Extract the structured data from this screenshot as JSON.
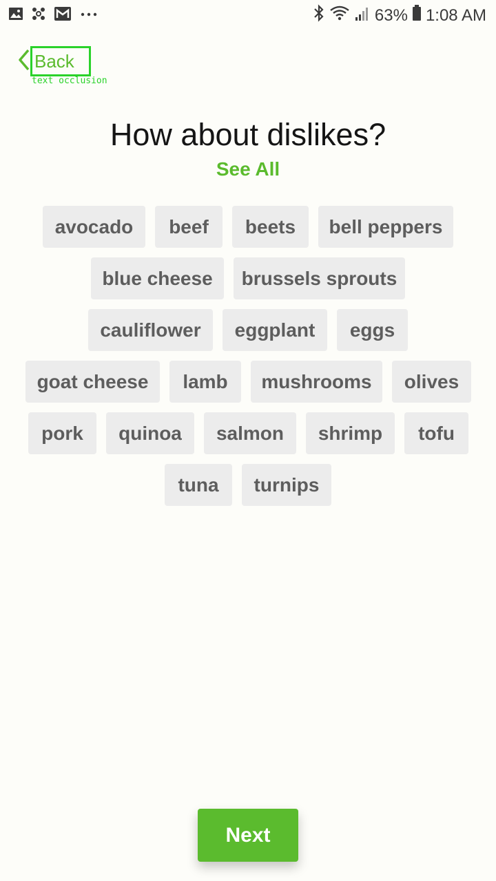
{
  "status_bar": {
    "battery": "63%",
    "time": "1:08 AM",
    "left_icons": [
      "image-icon",
      "pinwheel-icon",
      "gmail-icon",
      "more-dots-icon"
    ],
    "right_icons": [
      "bluetooth-icon",
      "wifi-icon",
      "signal-icon",
      "battery-icon"
    ]
  },
  "nav": {
    "back_label": "Back",
    "occlusion_label": "text occlusion"
  },
  "heading": {
    "title": "How about dislikes?",
    "see_all": "See All"
  },
  "chips": [
    "avocado",
    "beef",
    "beets",
    "bell peppers",
    "blue cheese",
    "brussels sprouts",
    "cauliflower",
    "eggplant",
    "eggs",
    "goat cheese",
    "lamb",
    "mushrooms",
    "olives",
    "pork",
    "quinoa",
    "salmon",
    "shrimp",
    "tofu",
    "tuna",
    "turnips"
  ],
  "footer": {
    "next_label": "Next"
  },
  "colors": {
    "accent": "#5bbb2e",
    "chip_bg": "#ececec",
    "chip_text": "#5d5d5d",
    "background": "#fdfdf9"
  }
}
